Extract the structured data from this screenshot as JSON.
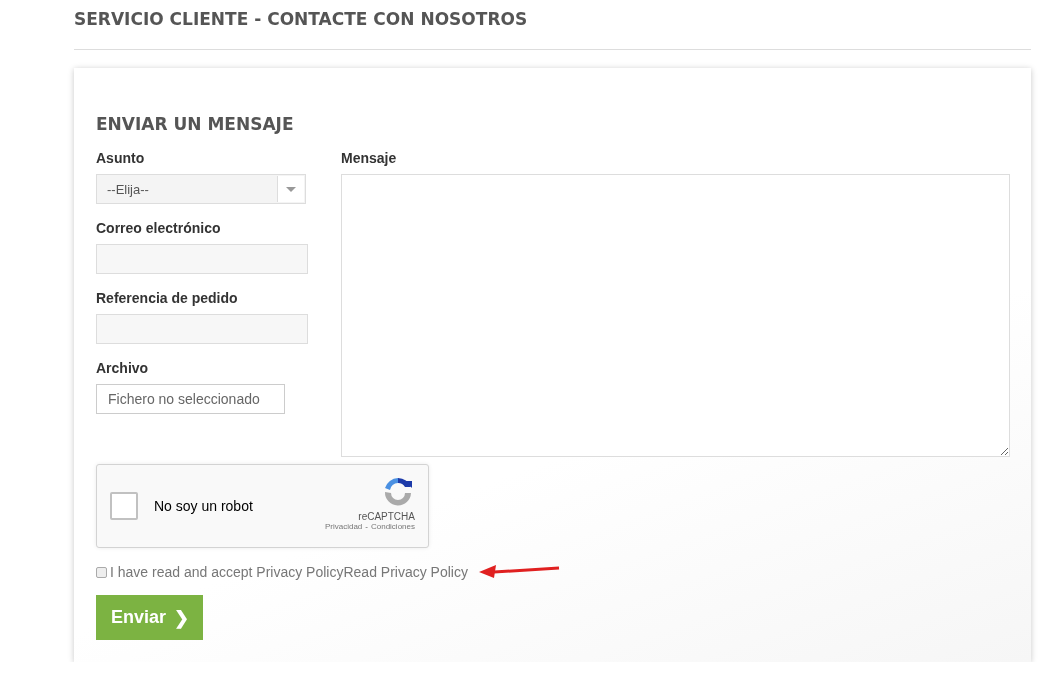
{
  "page_title": "SERVICIO CLIENTE - CONTACTE CON NOSOTROS",
  "form": {
    "heading": "ENVIAR UN MENSAJE",
    "subject": {
      "label": "Asunto",
      "value": "--Elija--"
    },
    "email": {
      "label": "Correo electrónico"
    },
    "order_reference": {
      "label": "Referencia de pedido"
    },
    "file": {
      "label": "Archivo",
      "value": "Fichero no seleccionado"
    },
    "message": {
      "label": "Mensaje"
    },
    "captcha": {
      "label": "No soy un robot",
      "checked": false,
      "brand": "reCAPTCHA",
      "privacy": "Privacidad",
      "separator": "-",
      "terms": "Condiciones"
    },
    "consent": {
      "checked": false,
      "label": "I have read and accept Privacy Policy",
      "link": "Read Privacy Policy"
    },
    "submit": {
      "label": "Enviar",
      "icon": "❯"
    }
  }
}
